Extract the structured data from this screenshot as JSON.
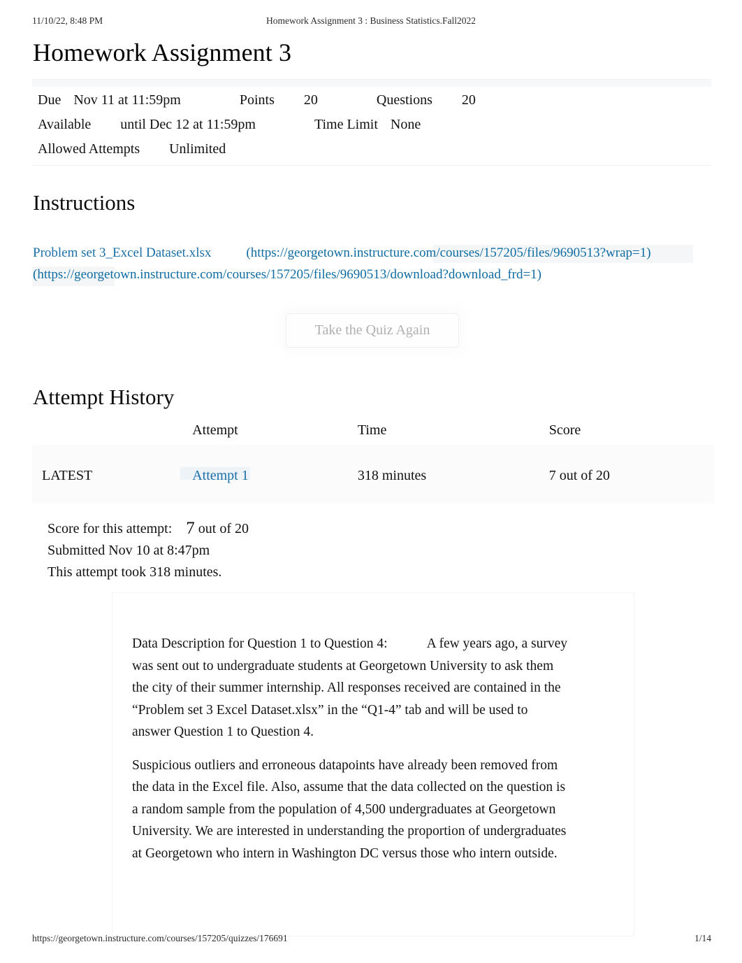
{
  "print_header": {
    "date": "11/10/22, 8:48 PM",
    "doc_title": "Homework Assignment 3 : Business Statistics.Fall2022"
  },
  "page": {
    "title": "Homework Assignment 3"
  },
  "meta": {
    "due_label": "Due",
    "due_value": "Nov 11 at 11:59pm",
    "points_label": "Points",
    "points_value": "20",
    "questions_label": "Questions",
    "questions_value": "20",
    "available_label": "Available",
    "available_value": "until Dec 12 at 11:59pm",
    "time_limit_label": "Time Limit",
    "time_limit_value": "None",
    "allowed_attempts_label": "Allowed Attempts",
    "allowed_attempts_value": "Unlimited"
  },
  "instructions": {
    "heading": "Instructions",
    "file_link_text": "Problem set 3_Excel Dataset.xlsx",
    "file_url_text": "(https://georgetown.instructure.com/courses/157205/files/9690513?wrap=1)",
    "download_url_text": "(https://georgetown.instructure.com/courses/157205/files/9690513/download?download_frd=1)"
  },
  "quiz_button": {
    "label": "Take the Quiz Again"
  },
  "attempt_history": {
    "heading": "Attempt History",
    "columns": [
      "",
      "Attempt",
      "Time",
      "Score"
    ],
    "rows": [
      {
        "marker": "LATEST",
        "attempt": "Attempt 1",
        "time": "318 minutes",
        "score": "7 out of 20"
      }
    ]
  },
  "attempt_summary": {
    "score_label": "Score for this attempt:",
    "score_number": "7",
    "score_suffix": "out of 20",
    "submitted": "Submitted Nov 10 at 8:47pm",
    "duration": "This attempt took 318 minutes."
  },
  "question_card": {
    "para1_lead": "Data Description for Question 1 to Question 4:",
    "para1_body": "A few years ago, a survey was sent out to undergraduate students at Georgetown University to ask them the city of their summer internship. All responses received are contained in the “Problem set 3 Excel Dataset.xlsx” in the “Q1-4” tab and will be used to answer Question 1 to Question 4.",
    "para2": "Suspicious outliers and erroneous datapoints have already been removed from the data in the Excel file. Also, assume that the data collected on the question is a random sample from the population of 4,500 undergraduates at Georgetown University. We are interested in understanding the proportion of undergraduates at Georgetown who intern in Washington DC versus those who intern outside."
  },
  "footer": {
    "url": "https://georgetown.instructure.com/courses/157205/quizzes/176691",
    "page_number": "1/14"
  },
  "colors": {
    "link": "#1a6fa8",
    "text": "#111111",
    "muted": "#a9aaab",
    "rule": "#f1f2f3"
  }
}
